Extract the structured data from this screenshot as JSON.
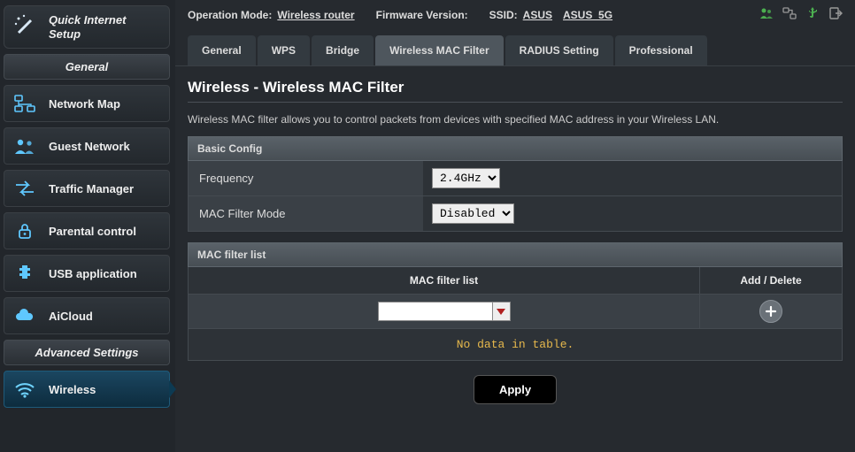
{
  "top": {
    "op_mode_label": "Operation Mode:",
    "op_mode_value": "Wireless router",
    "fw_label": "Firmware Version:",
    "ssid_label": "SSID:",
    "ssid1": "ASUS",
    "ssid2": "ASUS_5G"
  },
  "qis": {
    "label": "Quick Internet Setup"
  },
  "sections": {
    "general": "General",
    "advanced": "Advanced Settings"
  },
  "nav": {
    "network_map": "Network Map",
    "guest_network": "Guest Network",
    "traffic_manager": "Traffic Manager",
    "parental_control": "Parental control",
    "usb_application": "USB application",
    "aicloud": "AiCloud",
    "wireless": "Wireless"
  },
  "tabs": {
    "general": "General",
    "wps": "WPS",
    "bridge": "Bridge",
    "macfilter": "Wireless MAC Filter",
    "radius": "RADIUS Setting",
    "professional": "Professional"
  },
  "page": {
    "title": "Wireless - Wireless MAC Filter",
    "desc": "Wireless MAC filter allows you to control packets from devices with specified MAC address in your Wireless LAN."
  },
  "basic": {
    "header": "Basic Config",
    "freq_label": "Frequency",
    "freq_value": "2.4GHz",
    "mode_label": "MAC Filter Mode",
    "mode_value": "Disabled"
  },
  "maclist": {
    "header": "MAC filter list",
    "col_list": "MAC filter list",
    "col_action": "Add / Delete",
    "input_value": "",
    "empty": "No data in table."
  },
  "apply": "Apply"
}
